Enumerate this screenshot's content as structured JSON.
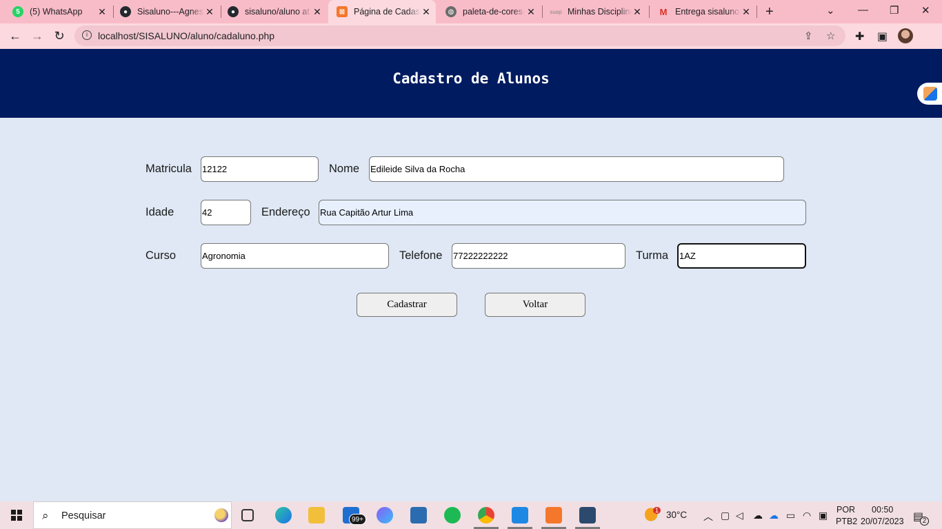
{
  "browser": {
    "tabs": [
      {
        "title": "(5) WhatsApp",
        "icon": "whatsapp-icon",
        "color": "#25d366",
        "glyph": "5"
      },
      {
        "title": "Sisaluno---Agnes",
        "icon": "github-icon",
        "color": "#24292f",
        "glyph": "●"
      },
      {
        "title": "sisaluno/aluno at",
        "icon": "github-icon",
        "color": "#24292f",
        "glyph": "●"
      },
      {
        "title": "Página de Cadastro",
        "icon": "xampp-icon",
        "color": "#f5772b",
        "glyph": "⊠",
        "active": true
      },
      {
        "title": "paleta-de-cores-",
        "icon": "globe-icon",
        "color": "#6b6b6b",
        "glyph": "◍"
      },
      {
        "title": "Minhas Disciplinas",
        "icon": "suap-icon",
        "color": "#b9b9b9",
        "glyph": "suap"
      },
      {
        "title": "Entrega sisaluno",
        "icon": "gmail-icon",
        "color": "#d93025",
        "glyph": "M"
      }
    ],
    "url": "localhost/SISALUNO/aluno/cadaluno.php"
  },
  "page": {
    "title": "Cadastro de Alunos",
    "form": {
      "matricula": {
        "label": "Matricula",
        "value": "12122"
      },
      "nome": {
        "label": "Nome",
        "value": "Edileide Silva da Rocha"
      },
      "idade": {
        "label": "Idade",
        "value": "42"
      },
      "endereco": {
        "label": "Endereço",
        "value": "Rua Capitão Artur Lima"
      },
      "curso": {
        "label": "Curso",
        "value": "Agronomia"
      },
      "telefone": {
        "label": "Telefone",
        "value": "77222222222"
      },
      "turma": {
        "label": "Turma",
        "value": "1AZ"
      }
    },
    "buttons": {
      "submit": "Cadastrar",
      "back": "Voltar"
    }
  },
  "taskbar": {
    "search_placeholder": "Pesquisar",
    "mail_badge": "99+",
    "weather": {
      "alert": "1",
      "temp": "30°C"
    },
    "lang": {
      "line1": "POR",
      "line2": "PTB2"
    },
    "clock": {
      "time": "00:50",
      "date": "20/07/2023"
    },
    "notifications": "2"
  }
}
